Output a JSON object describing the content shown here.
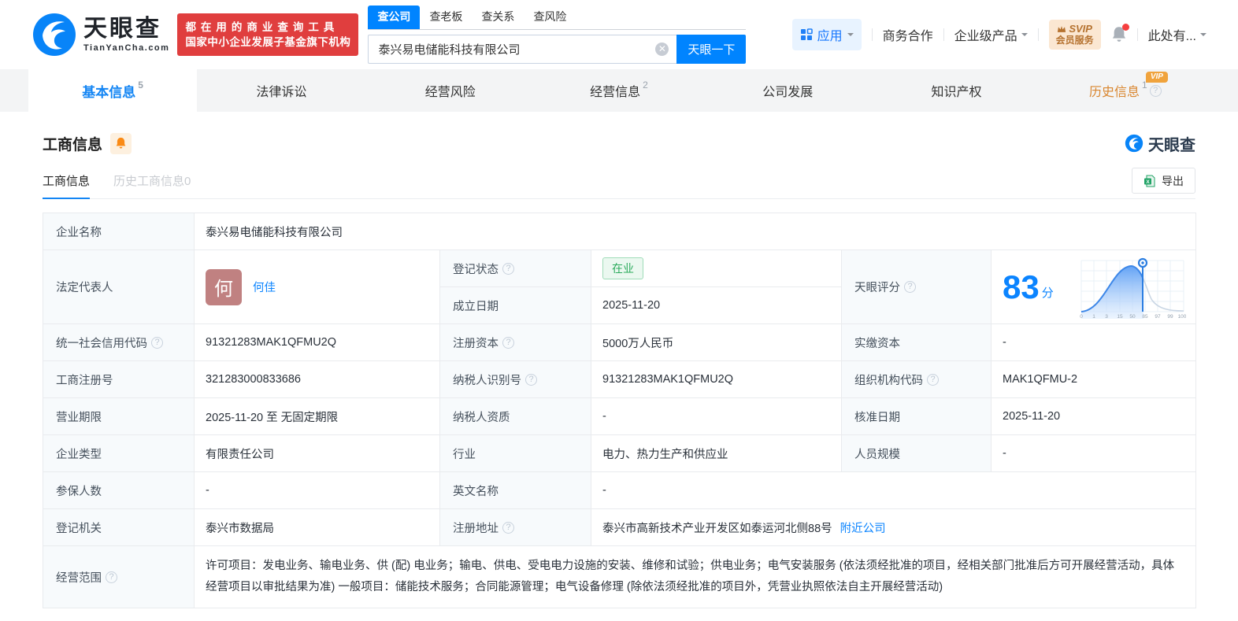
{
  "header": {
    "logo": {
      "name": "天眼查",
      "domain": "TianYanCha.com"
    },
    "promo": {
      "line1": "都在用的商业查询工具",
      "line2": "国家中小企业发展子基金旗下机构"
    },
    "search": {
      "tabs": [
        {
          "label": "查公司"
        },
        {
          "label": "查老板"
        },
        {
          "label": "查关系"
        },
        {
          "label": "查风险"
        }
      ],
      "value": "泰兴易电储能科技有限公司",
      "button": "天眼一下"
    },
    "nav_right": {
      "apps": "应用",
      "cooperation": "商务合作",
      "enterprise": "企业级产品",
      "svip_line1": "SVIP",
      "svip_line2": "会员服务",
      "user": "此处有..."
    }
  },
  "nav": {
    "tabs": [
      {
        "label": "基本信息",
        "count": "5"
      },
      {
        "label": "法律诉讼",
        "count": ""
      },
      {
        "label": "经营风险",
        "count": ""
      },
      {
        "label": "经营信息",
        "count": "2"
      },
      {
        "label": "公司发展",
        "count": ""
      },
      {
        "label": "知识产权",
        "count": ""
      },
      {
        "label": "历史信息",
        "count": "1",
        "vip": "VIP"
      }
    ]
  },
  "section": {
    "title": "工商信息",
    "subtab_active": "工商信息",
    "subtab_history": "历史工商信息0",
    "watermark": "天眼查",
    "export": "导出"
  },
  "score": {
    "label": "天眼评分",
    "value": "83",
    "unit": "分",
    "ticks": [
      "0",
      "1",
      "3",
      "15",
      "50",
      "85",
      "97",
      "99",
      "100"
    ]
  },
  "fields": {
    "company_name": {
      "label": "企业名称",
      "value": "泰兴易电储能科技有限公司"
    },
    "legal_rep": {
      "label": "法定代表人",
      "value": "何佳",
      "avatar": "何"
    },
    "reg_status": {
      "label": "登记状态",
      "value": "在业"
    },
    "establish_date": {
      "label": "成立日期",
      "value": "2025-11-20"
    },
    "credit_code": {
      "label": "统一社会信用代码",
      "value": "91321283MAK1QFMU2Q"
    },
    "reg_capital": {
      "label": "注册资本",
      "value": "5000万人民币"
    },
    "paid_capital": {
      "label": "实缴资本",
      "value": "-"
    },
    "reg_number": {
      "label": "工商注册号",
      "value": "321283000833686"
    },
    "taxpayer_id": {
      "label": "纳税人识别号",
      "value": "91321283MAK1QFMU2Q"
    },
    "org_code": {
      "label": "组织机构代码",
      "value": "MAK1QFMU-2"
    },
    "business_term": {
      "label": "营业期限",
      "value": "2025-11-20 至 无固定期限"
    },
    "taxpayer_quality": {
      "label": "纳税人资质",
      "value": "-"
    },
    "approval_date": {
      "label": "核准日期",
      "value": "2025-11-20"
    },
    "company_type": {
      "label": "企业类型",
      "value": "有限责任公司"
    },
    "industry": {
      "label": "行业",
      "value": "电力、热力生产和供应业"
    },
    "staff_size": {
      "label": "人员规模",
      "value": "-"
    },
    "insured_count": {
      "label": "参保人数",
      "value": "-"
    },
    "english_name": {
      "label": "英文名称",
      "value": "-"
    },
    "reg_authority": {
      "label": "登记机关",
      "value": "泰兴市数据局"
    },
    "reg_address": {
      "label": "注册地址",
      "value": "泰兴市高新技术产业开发区如泰运河北侧88号",
      "link": "附近公司"
    },
    "business_scope": {
      "label": "经营范围",
      "value": "许可项目：发电业务、输电业务、供 (配) 电业务；输电、供电、受电电力设施的安装、维修和试验；供电业务；电气安装服务 (依法须经批准的项目，经相关部门批准后方可开展经营活动，具体经营项目以审批结果为准) 一般项目：储能技术服务；合同能源管理；电气设备修理 (除依法须经批准的项目外，凭营业执照依法自主开展经营活动)"
    }
  },
  "colors": {
    "brand_blue": "#0084ff",
    "promo_red": "#e03e3e",
    "status_green": "#2cab5c",
    "vip_orange": "#f0a33c"
  }
}
